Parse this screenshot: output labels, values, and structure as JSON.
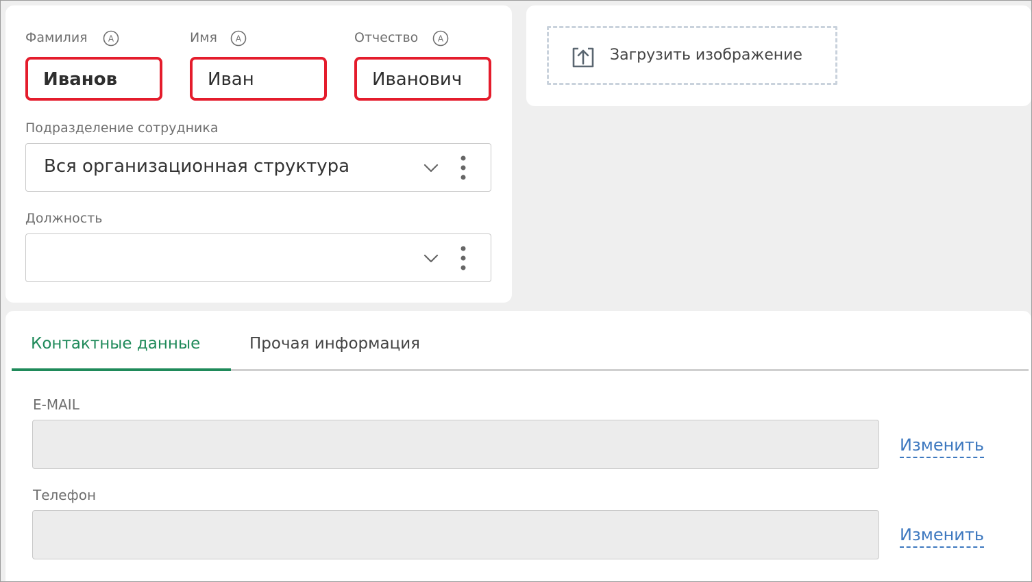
{
  "personal": {
    "last_name": {
      "label": "Фамилия",
      "value": "Иванов",
      "auto_icon": "auto-a-icon"
    },
    "first_name": {
      "label": "Имя",
      "value": "Иван",
      "auto_icon": "auto-a-icon"
    },
    "middle_name": {
      "label": "Отчество",
      "value": "Иванович",
      "auto_icon": "auto-a-icon"
    },
    "highlight_color": "#e41c2c",
    "department": {
      "label": "Подразделение сотрудника",
      "value": "Вся организационная структура"
    },
    "position": {
      "label": "Должность",
      "value": ""
    }
  },
  "upload": {
    "label": "Загрузить изображение",
    "icon": "upload-icon"
  },
  "tabs": {
    "items": [
      {
        "label": "Контактные данные",
        "active": true
      },
      {
        "label": "Прочая информация",
        "active": false
      }
    ],
    "accent_color": "#1f8a5a"
  },
  "contacts": {
    "email": {
      "label": "E-MAIL",
      "value": "",
      "action": "Изменить"
    },
    "phone": {
      "label": "Телефон",
      "value": "",
      "action": "Изменить"
    },
    "link_color": "#3d78bf"
  }
}
